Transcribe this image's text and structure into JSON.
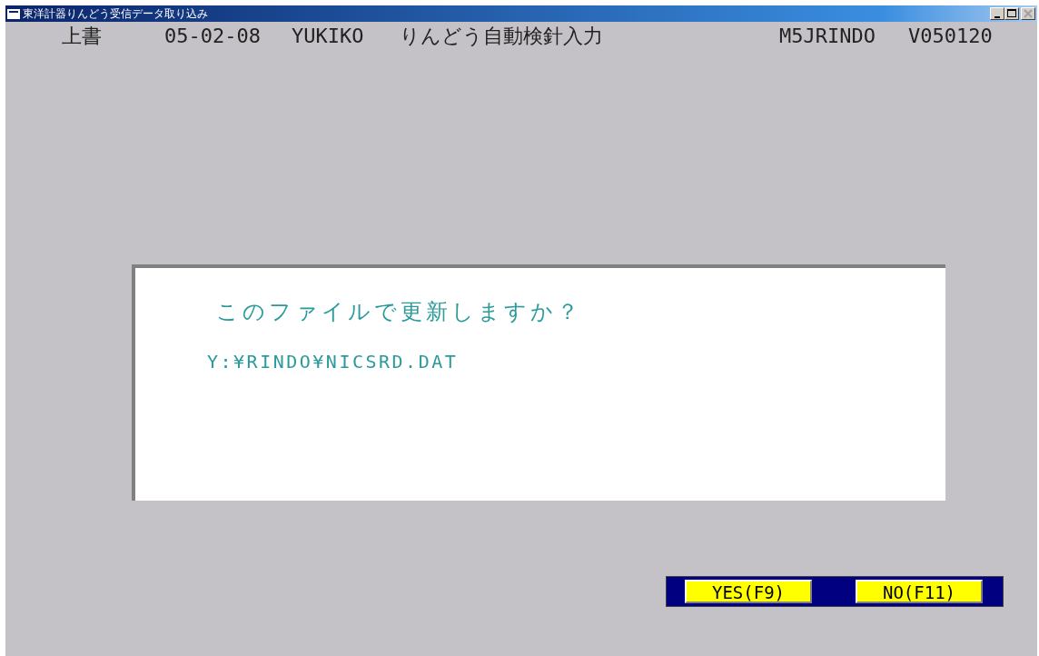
{
  "window": {
    "title": "東洋計器りんどう受信データ取り込み",
    "controls": [
      {
        "kind": "minimize",
        "disabled": false
      },
      {
        "kind": "maximize",
        "disabled": false
      },
      {
        "kind": "close",
        "disabled": true
      }
    ]
  },
  "header": [
    "上書",
    "05-02-08",
    "YUKIKO",
    "りんどう自動検針入力",
    "M5JRINDO",
    "V050120"
  ],
  "dialog": {
    "question": "このファイルで更新しますか？",
    "path": "Y:¥RINDO¥NICSRD.DAT"
  },
  "buttons": [
    "YES(F9)",
    "NO(F11)"
  ]
}
